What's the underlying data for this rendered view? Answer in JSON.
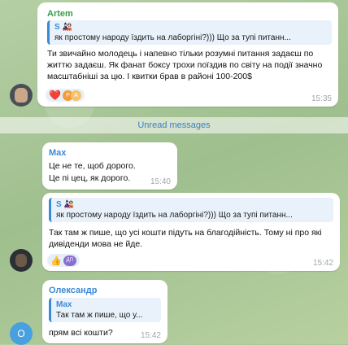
{
  "divider": {
    "label": "Unread messages"
  },
  "messages": [
    {
      "sender": "Artem",
      "reply": {
        "name": "S 🎎",
        "text": "як простому народу їздить на лаборгіні?))) Що за тупі питанн..."
      },
      "text": "Ти звичайно молодець і напевно тільки розумні питання задаєш по життю задаєш. Як фанат боксу трохи поїздив по світу на події значно масштабніші за цю. І квитки брав в районі 100-200$",
      "reactions": {
        "heart": "❤️"
      },
      "time": "15:35"
    },
    {
      "sender": "Max",
      "lines": [
        "Це не те, щоб дорого.",
        "Це пі   цец, як дорого."
      ],
      "time": "15:40"
    },
    {
      "reply": {
        "name": "S 🎎",
        "text": "як простому народу їздить на лаборгіні?))) Що за тупі питанн..."
      },
      "text": "Так там ж пише, що усі кошти підуть на благодійність. Тому ні про які дивіденди мова не йде.",
      "reactions": {
        "emoji": "👍",
        "badge": "ДП"
      },
      "time": "15:42"
    },
    {
      "sender": "Олександр",
      "reply": {
        "name": "Max",
        "text": "Так там ж пише, що у..."
      },
      "text": "прям всі кошти?",
      "avatar_letter": "О",
      "time": "15:42"
    }
  ]
}
